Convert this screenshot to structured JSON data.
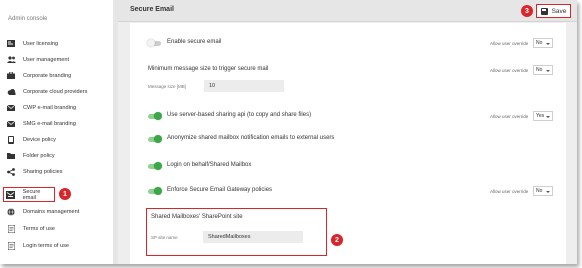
{
  "sidebar": {
    "title": "Admin console",
    "items": [
      {
        "label": "User licensing",
        "icon": "id-card-icon"
      },
      {
        "label": "User management",
        "icon": "users-icon"
      },
      {
        "label": "Corporate branding",
        "icon": "briefcase-icon"
      },
      {
        "label": "Corporate cloud providers",
        "icon": "cloud-icon"
      },
      {
        "label": "CWP e-mail branding",
        "icon": "envelope-icon"
      },
      {
        "label": "SMG e-mail branding",
        "icon": "envelope-icon"
      },
      {
        "label": "Device policy",
        "icon": "mobile-icon"
      },
      {
        "label": "Folder policy",
        "icon": "folder-icon"
      },
      {
        "label": "Sharing policies",
        "icon": "share-icon"
      },
      {
        "label": "Secure email",
        "icon": "secure-envelope-icon",
        "active": true
      },
      {
        "label": "Domains management",
        "icon": "globe-icon"
      },
      {
        "label": "Terms of use",
        "icon": "document-icon"
      },
      {
        "label": "Login terms of use",
        "icon": "document-icon"
      }
    ]
  },
  "header": {
    "title": "Secure Email",
    "save_label": "Save"
  },
  "settings": {
    "enable_secure_email": {
      "label": "Enable secure email",
      "on": false,
      "override_label": "Allow user override",
      "override_value": "No"
    },
    "min_size": {
      "label": "Minimum message size to trigger secure mail",
      "field_label": "Message size [MB]",
      "value": "10",
      "override_label": "Allow user override",
      "override_value": "No"
    },
    "server_sharing": {
      "label": "Use server-based sharing api (to copy and share files)",
      "on": true,
      "override_label": "Allow user override",
      "override_value": "Yes"
    },
    "anonymize": {
      "label": "Anonymize shared mailbox notification emails to external users",
      "on": true
    },
    "login_behalf": {
      "label": "Login on behalf/Shared Mailbox",
      "on": true
    },
    "enforce_gateway": {
      "label": "Enforce Secure Email Gateway policies",
      "on": true,
      "override_label": "Allow user override",
      "override_value": "No"
    },
    "sharepoint": {
      "title": "Shared Mailboxes' SharePoint site",
      "field_label": "SP site name",
      "value": "SharedMailboxes"
    }
  },
  "badges": {
    "one": "1",
    "two": "2",
    "three": "3"
  },
  "colors": {
    "accent_red": "#d9262c",
    "toggle_on": "#3aa845"
  }
}
